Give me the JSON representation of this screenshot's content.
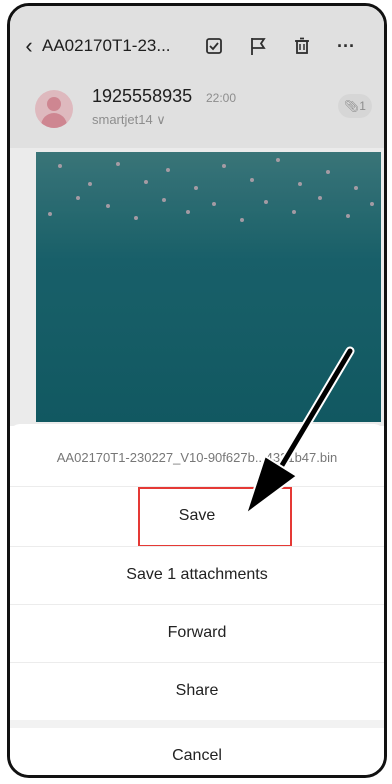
{
  "header": {
    "back_icon": "chevron-left-icon",
    "subject": "AA02170T1-23...",
    "icons": [
      "checkbox-icon",
      "flag-icon",
      "trash-icon",
      "more-icon"
    ],
    "more_label": "···"
  },
  "sender": {
    "name": "1925558935",
    "time": "22:00",
    "recipient": "smartjet14 ∨",
    "attachment_count": "1"
  },
  "sheet": {
    "filename": "AA02170T1-230227_V10-90f627b...4321b47.bin",
    "options": {
      "save": "Save",
      "save_attachments": "Save 1 attachments",
      "forward": "Forward",
      "share": "Share",
      "cancel": "Cancel"
    }
  },
  "colors": {
    "banner": "#1b6872",
    "highlight": "#e53935",
    "arrow": "#000000"
  }
}
